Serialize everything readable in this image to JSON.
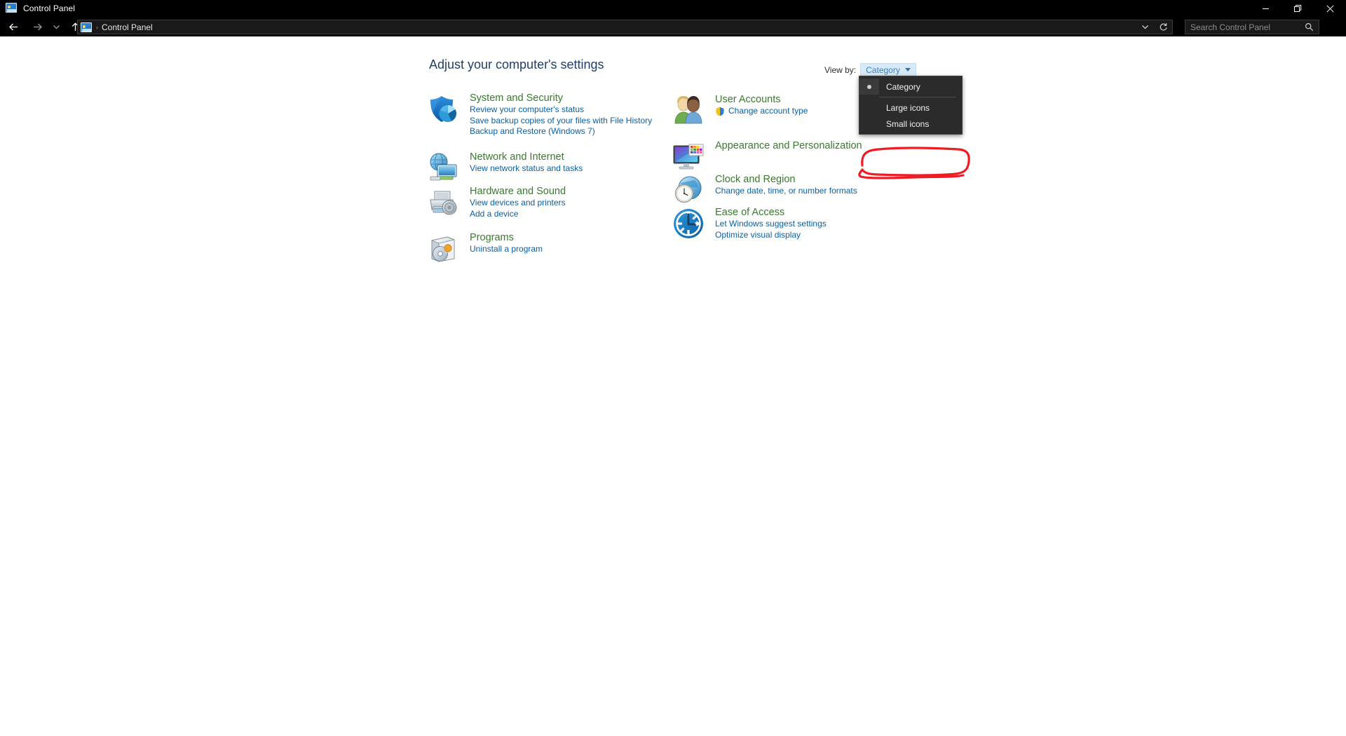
{
  "window": {
    "title": "Control Panel",
    "icon": "control-panel-icon",
    "controls": {
      "minimize": "minimize-icon",
      "maximize": "restore-icon",
      "close": "close-icon"
    }
  },
  "navbar": {
    "back": "back-arrow-icon",
    "forward": "forward-arrow-icon",
    "recent": "chevron-down-icon",
    "up": "up-arrow-icon",
    "breadcrumb": "Control Panel",
    "breadcrumb_separator": "›",
    "history_chevron": "chevron-down-icon",
    "refresh": "refresh-icon"
  },
  "search": {
    "placeholder": "Search Control Panel",
    "value": "",
    "icon": "search-icon"
  },
  "main": {
    "heading": "Adjust your computer's settings",
    "view_by": {
      "label": "View by:",
      "selected": "Category",
      "caret": "chevron-down-icon",
      "options": [
        {
          "label": "Category",
          "checked": true
        },
        {
          "label": "Large icons",
          "checked": false
        },
        {
          "label": "Small icons",
          "checked": false
        }
      ]
    },
    "annotation": {
      "shape": "hand-drawn-rectangle",
      "color": "#ee1c25",
      "targets": "Small icons"
    },
    "columns": [
      {
        "items": [
          {
            "icon": "security-shield-icon",
            "title": "System and Security",
            "links": [
              {
                "text": "Review your computer's status",
                "shield": false
              },
              {
                "text": "Save backup copies of your files with File History",
                "shield": false
              },
              {
                "text": "Backup and Restore (Windows 7)",
                "shield": false
              }
            ]
          },
          {
            "icon": "network-globe-icon",
            "title": "Network and Internet",
            "links": [
              {
                "text": "View network status and tasks",
                "shield": false
              }
            ]
          },
          {
            "icon": "printer-hardware-icon",
            "title": "Hardware and Sound",
            "links": [
              {
                "text": "View devices and printers",
                "shield": false
              },
              {
                "text": "Add a device",
                "shield": false
              }
            ]
          },
          {
            "icon": "programs-disc-icon",
            "title": "Programs",
            "links": [
              {
                "text": "Uninstall a program",
                "shield": false
              }
            ]
          }
        ]
      },
      {
        "items": [
          {
            "icon": "user-accounts-icon",
            "title": "User Accounts",
            "links": [
              {
                "text": "Change account type",
                "shield": true
              }
            ]
          },
          {
            "icon": "appearance-monitor-icon",
            "title": "Appearance and Personalization",
            "links": []
          },
          {
            "icon": "clock-region-icon",
            "title": "Clock and Region",
            "links": [
              {
                "text": "Change date, time, or number formats",
                "shield": false
              }
            ]
          },
          {
            "icon": "ease-of-access-icon",
            "title": "Ease of Access",
            "links": [
              {
                "text": "Let Windows suggest settings",
                "shield": false
              },
              {
                "text": "Optimize visual display",
                "shield": false
              }
            ]
          }
        ]
      }
    ]
  },
  "colors": {
    "title_bar_bg": "#000000",
    "category_title": "#3a7a2e",
    "link": "#0a5fa8",
    "heading": "#1f3f66",
    "viewby_accent": "#3b7fc4",
    "annotation_red": "#ee1c25",
    "menu_bg": "#2b2b2b"
  }
}
